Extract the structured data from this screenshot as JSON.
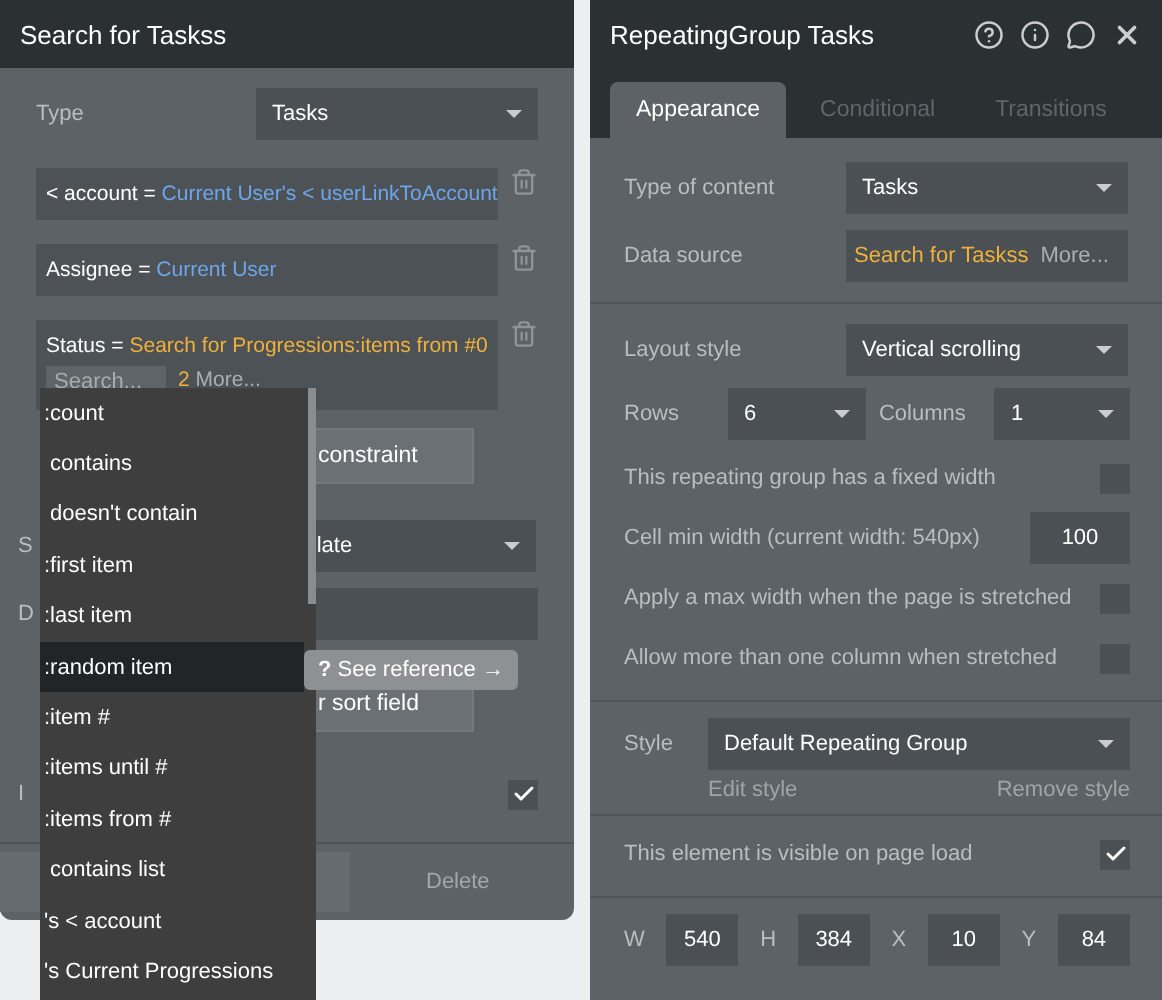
{
  "search_panel": {
    "title": "Search for Taskss",
    "type": {
      "label": "Type",
      "value": "Tasks"
    },
    "constraints": [
      {
        "field": "< account =",
        "value": "Current User's < userLinkToAccount",
        "kind": "link"
      },
      {
        "field": "Assignee =",
        "value": "Current User",
        "kind": "link"
      },
      {
        "field": "Status =",
        "value": "Search for Progressions:items from #0",
        "kind": "expression",
        "search_placeholder": "Search...",
        "more_count": "2",
        "more": "More..."
      }
    ],
    "add_constraint": "constraint",
    "sort_label": "S",
    "sort_value": "late",
    "descending_label": "D",
    "sort_field_button": "r sort field",
    "ignore_label": "I",
    "ignore_checked": true,
    "delete_button": "Delete"
  },
  "dropdown": {
    "items": [
      {
        "label": ":count",
        "selected": false
      },
      {
        "label": " contains",
        "selected": false
      },
      {
        "label": " doesn't contain",
        "selected": false
      },
      {
        "label": ":first item",
        "selected": false
      },
      {
        "label": ":last item",
        "selected": false
      },
      {
        "label": ":random item",
        "selected": true
      },
      {
        "label": ":item #",
        "selected": false
      },
      {
        "label": ":items until #",
        "selected": false
      },
      {
        "label": ":items from #",
        "selected": false
      },
      {
        "label": " contains list",
        "selected": false
      },
      {
        "label": "'s < account",
        "selected": false
      },
      {
        "label": "'s Current Progressions",
        "selected": false
      }
    ]
  },
  "tooltip": {
    "icon": "?",
    "label": "See reference →"
  },
  "properties_panel": {
    "title": "RepeatingGroup Tasks",
    "tabs": [
      {
        "label": "Appearance",
        "selected": true
      },
      {
        "label": "Conditional",
        "selected": false
      },
      {
        "label": "Transitions",
        "selected": false
      }
    ],
    "type_of_content": {
      "label": "Type of content",
      "value": "Tasks"
    },
    "data_source": {
      "label": "Data source",
      "value": "Search for Taskss",
      "more": "More..."
    },
    "layout_style": {
      "label": "Layout style",
      "value": "Vertical scrolling"
    },
    "rows": {
      "label": "Rows",
      "value": "6"
    },
    "columns": {
      "label": "Columns",
      "value": "1"
    },
    "options": [
      {
        "label": "This repeating group has a fixed width",
        "kind": "checkbox",
        "checked": false
      },
      {
        "label": "Cell min width (current width: 540px)",
        "kind": "number",
        "value": "100"
      },
      {
        "label": "Apply a max width when the page is stretched",
        "kind": "checkbox",
        "checked": false
      },
      {
        "label": "Allow more than one column when stretched",
        "kind": "checkbox",
        "checked": false
      }
    ],
    "style": {
      "label": "Style",
      "value": "Default Repeating Group",
      "edit": "Edit style",
      "remove": "Remove style"
    },
    "visible": {
      "label": "This element is visible on page load",
      "checked": true
    },
    "geometry": [
      {
        "label": "W",
        "value": "540"
      },
      {
        "label": "H",
        "value": "384"
      },
      {
        "label": "X",
        "value": "10"
      },
      {
        "label": "Y",
        "value": "84"
      }
    ]
  }
}
